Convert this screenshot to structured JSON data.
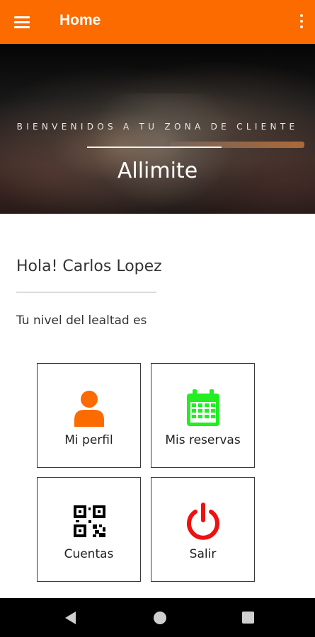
{
  "app_bar": {
    "title": "Home",
    "background_color": "#fb6b00",
    "menu_icon": "hamburger-menu-icon",
    "overflow_icon": "more-vert-icon"
  },
  "hero": {
    "subtitle": "BIENVENIDOS A TU ZONA DE CLIENTE",
    "title": "Allimite"
  },
  "main": {
    "greeting": "Hola! Carlos Lopez",
    "loyalty_text": "Tu nivel del lealtad es"
  },
  "tiles": [
    {
      "label": "Mi perfil",
      "icon": "person-icon",
      "color": "#fb6b00"
    },
    {
      "label": "Mis reservas",
      "icon": "calendar-icon",
      "color": "#22ee22"
    },
    {
      "label": "Cuentas",
      "icon": "qr-code-icon",
      "color": "#000000"
    },
    {
      "label": "Salir",
      "icon": "power-icon",
      "color": "#ee1111"
    }
  ],
  "system_nav": {
    "back_icon": "back-triangle-icon",
    "home_icon": "home-circle-icon",
    "recents_icon": "recents-square-icon"
  }
}
